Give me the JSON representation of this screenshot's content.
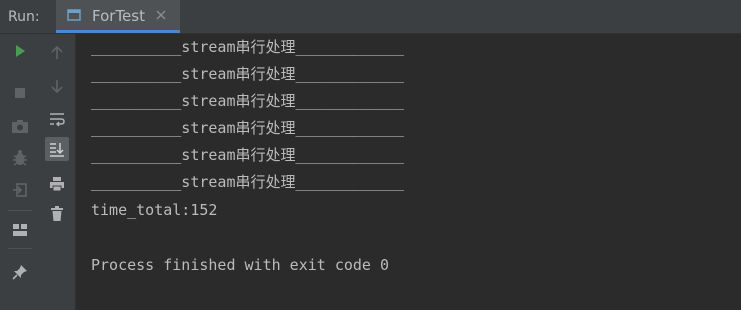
{
  "header": {
    "run_label": "Run:",
    "tab_title": "ForTest"
  },
  "toolbar": {
    "left_column": [
      "rerun-icon",
      "stop-icon",
      "camera-icon",
      "debug-icon",
      "exit-icon",
      "layout-icon",
      "pin-icon"
    ],
    "right_column": [
      "up-arrow-icon",
      "down-arrow-icon",
      "soft-wrap-icon",
      "scroll-to-end-icon",
      "print-icon",
      "trash-icon"
    ]
  },
  "console": {
    "lines": [
      "__________stream串行处理____________",
      "__________stream串行处理____________",
      "__________stream串行处理____________",
      "__________stream串行处理____________",
      "__________stream串行处理____________",
      "__________stream串行处理____________",
      "time_total:152",
      "",
      "Process finished with exit code 0"
    ]
  },
  "colors": {
    "run_green": "#499c54",
    "tab_accent": "#4a88c7",
    "console_text": "#bbbbbb",
    "background": "#2b2b2b"
  }
}
